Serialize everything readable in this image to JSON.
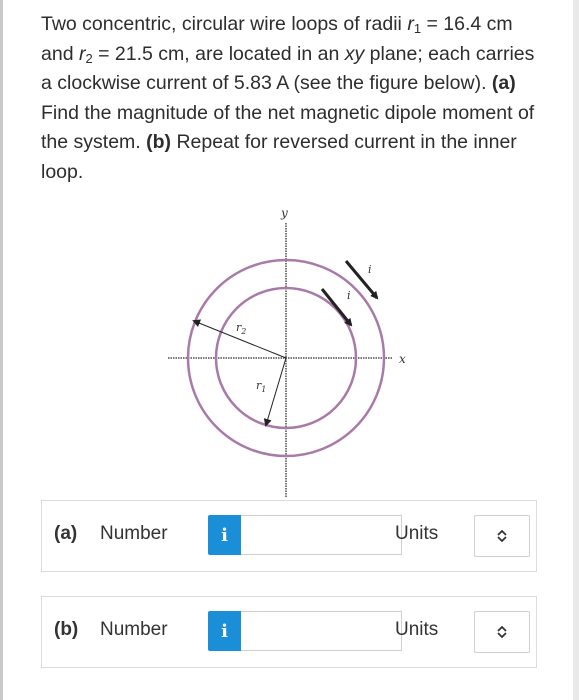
{
  "question": {
    "p1": "Two concentric, circular wire loops of radii ",
    "r1_sym": "r",
    "r1_sub": "1",
    "p2": " = 16.4 cm and ",
    "r2_sym": "r",
    "r2_sub": "2",
    "p3": " = 21.5 cm, are located in an ",
    "xy": "xy",
    "p4": " plane; each carries a clockwise current of 5.83 A (see the figure below). ",
    "a_label": "(a)",
    "a_text": " Find the magnitude of the net magnetic dipole moment of the system. ",
    "b_label": "(b)",
    "b_text": " Repeat for reversed current in the inner loop."
  },
  "figure": {
    "y_axis": "y",
    "x_axis": "x",
    "r2_label": "r",
    "r2_sub": "2",
    "r1_label": "r",
    "r1_sub": "1",
    "current_outer": "i",
    "current_inner": "i",
    "colors": {
      "loop": "#a87aa8",
      "axis": "#777777",
      "arrow": "#222222"
    }
  },
  "answers": [
    {
      "part": "(a)",
      "number_label": "Number",
      "info_icon": "i",
      "value": "",
      "units_label": "Units",
      "select_icon": "updown-chevron-icon"
    },
    {
      "part": "(b)",
      "number_label": "Number",
      "info_icon": "i",
      "value": "",
      "units_label": "Units",
      "select_icon": "updown-chevron-icon"
    }
  ]
}
